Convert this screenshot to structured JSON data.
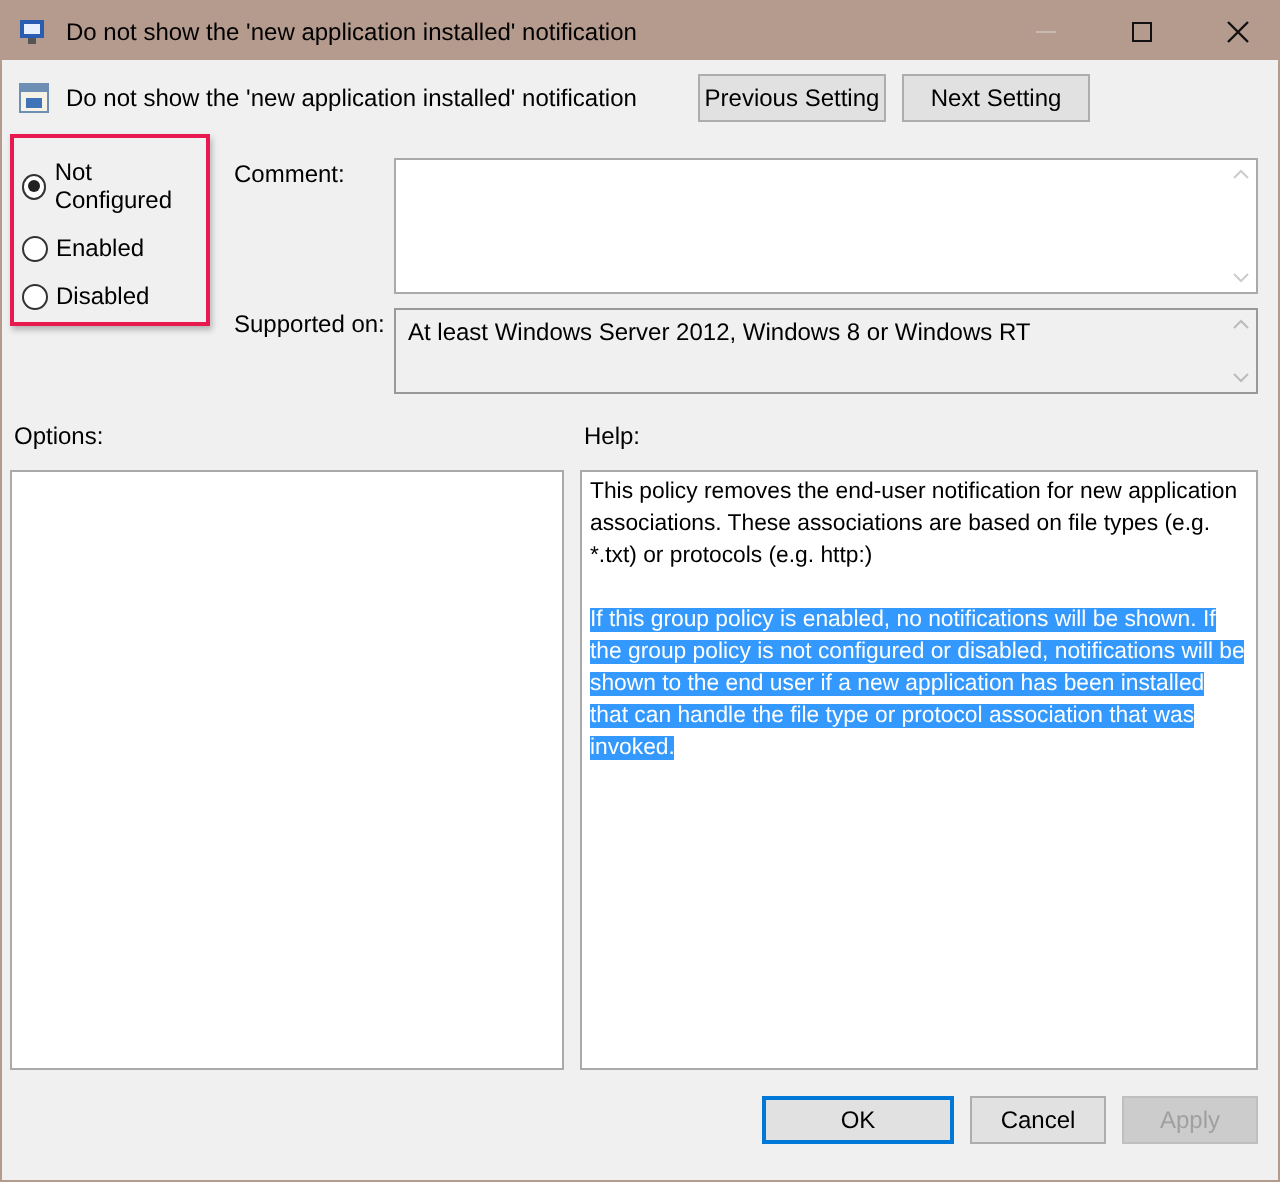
{
  "window": {
    "title": "Do not show the 'new application installed' notification"
  },
  "policy_title": "Do not show the 'new application installed' notification",
  "nav_buttons": [
    {
      "label": "Previous Setting",
      "disabled": false
    },
    {
      "label": "Next Setting",
      "disabled": false
    }
  ],
  "options_state": [
    {
      "label": "Not Configured",
      "selected": true
    },
    {
      "label": "Enabled",
      "selected": false
    },
    {
      "label": "Disabled",
      "selected": false
    }
  ],
  "comment": {
    "label": "Comment:"
  },
  "supported_on": {
    "label": "Supported on:",
    "value": "At least Windows Server 2012, Windows 8 or Windows RT"
  },
  "options": {
    "label": "Options:"
  },
  "help": {
    "label": "Help:",
    "paragraphs": [
      {
        "text": "This policy removes the end-user notification for new application associations. These associations are based on file types (e.g. *.txt) or protocols (e.g. http:)",
        "selected": false
      },
      {
        "text": "If this group policy is enabled, no notifications will be shown. If the group policy is not configured or disabled, notifications will be shown to the end user if a new application has been installed that can handle the file type or protocol association that was invoked.",
        "selected": true
      }
    ]
  },
  "buttons": [
    {
      "label": "OK",
      "default": true,
      "disabled": false
    },
    {
      "label": "Cancel",
      "default": false,
      "disabled": false
    },
    {
      "label": "Apply",
      "default": false,
      "disabled": true
    }
  ]
}
